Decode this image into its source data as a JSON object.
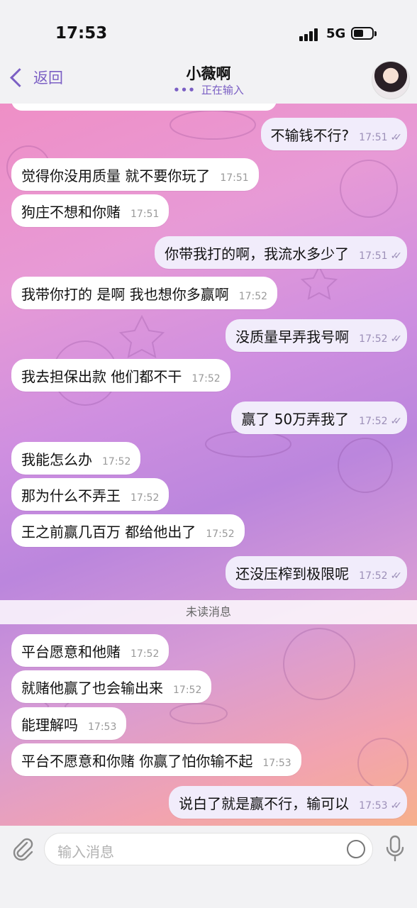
{
  "status_bar": {
    "time": "17:53",
    "network": "5G",
    "battery_percent": 55
  },
  "header": {
    "back_label": "返回",
    "title": "小薇啊",
    "typing_status": "正在输入"
  },
  "messages": [
    {
      "text": "不输钱不行?",
      "time": "17:51",
      "direction": "out"
    },
    {
      "text": "觉得你没用质量 就不要你玩了",
      "time": "17:51",
      "direction": "in"
    },
    {
      "text": "狗庄不想和你赌",
      "time": "17:51",
      "direction": "in"
    },
    {
      "text": "你带我打的啊，我流水多少了",
      "time": "17:51",
      "direction": "out"
    },
    {
      "text": "我带你打的 是啊 我也想你多赢啊",
      "time": "17:52",
      "direction": "in"
    },
    {
      "text": "没质量早弄我号啊",
      "time": "17:52",
      "direction": "out"
    },
    {
      "text": "我去担保出款 他们都不干",
      "time": "17:52",
      "direction": "in"
    },
    {
      "text": "赢了 50万弄我了",
      "time": "17:52",
      "direction": "out"
    },
    {
      "text": "我能怎么办",
      "time": "17:52",
      "direction": "in"
    },
    {
      "text": "那为什么不弄王",
      "time": "17:52",
      "direction": "in"
    },
    {
      "text": "王之前赢几百万 都给他出了",
      "time": "17:52",
      "direction": "in"
    },
    {
      "text": "还没压榨到极限呢",
      "time": "17:52",
      "direction": "out"
    },
    {
      "text": "平台愿意和他赌",
      "time": "17:52",
      "direction": "in"
    },
    {
      "text": "就赌他赢了也会输出来",
      "time": "17:52",
      "direction": "in"
    },
    {
      "text": "能理解吗",
      "time": "17:53",
      "direction": "in"
    },
    {
      "text": "平台不愿意和你赌 你赢了怕你输不起",
      "time": "17:53",
      "direction": "in"
    },
    {
      "text": "说白了就是赢不行，输可以",
      "time": "17:53",
      "direction": "out"
    }
  ],
  "unread_divider": "未读消息",
  "input": {
    "placeholder": "输入消息"
  },
  "icons": {
    "back": "chevron-left-icon",
    "attach": "paperclip-icon",
    "sticker": "sticker-icon",
    "mic": "microphone-icon",
    "read": "double-check-icon"
  },
  "colors": {
    "accent": "#7b5fc4",
    "outgoing_bubble": "#f1ecfb",
    "incoming_bubble": "#ffffff"
  }
}
